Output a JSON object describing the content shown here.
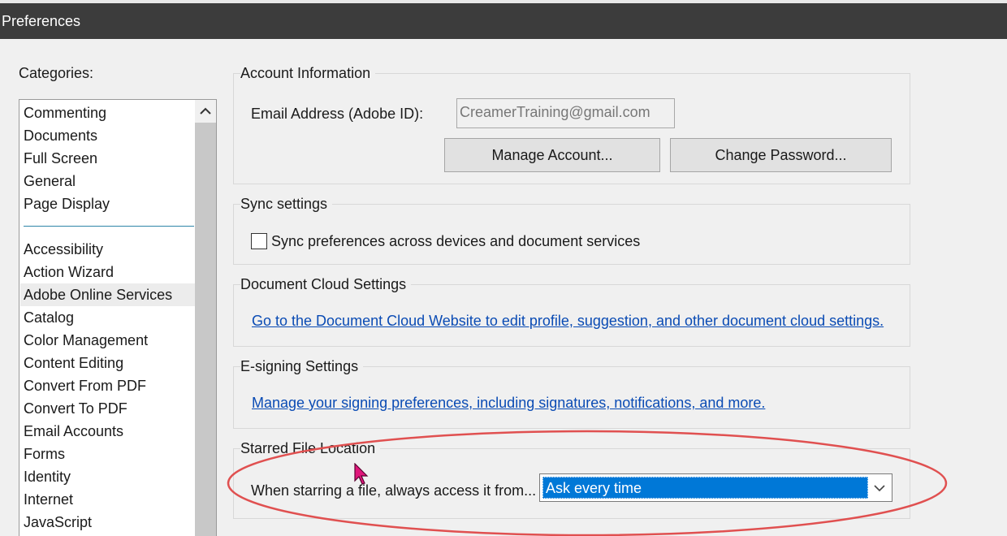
{
  "window": {
    "title": "Preferences"
  },
  "categories": {
    "label": "Categories:",
    "top_items": [
      "Commenting",
      "Documents",
      "Full Screen",
      "General",
      "Page Display"
    ],
    "items": [
      "Accessibility",
      "Action Wizard",
      "Adobe Online Services",
      "Catalog",
      "Color Management",
      "Content Editing",
      "Convert From PDF",
      "Convert To PDF",
      "Email Accounts",
      "Forms",
      "Identity",
      "Internet",
      "JavaScript"
    ],
    "selected": "Adobe Online Services"
  },
  "account": {
    "title": "Account Information",
    "email_label": "Email Address (Adobe ID):",
    "email_value": "CreamerTraining@gmail.com",
    "manage_button": "Manage Account...",
    "password_button": "Change Password..."
  },
  "sync": {
    "title": "Sync settings",
    "checkbox_label": "Sync preferences across devices and document services",
    "checked": false
  },
  "document_cloud": {
    "title": "Document Cloud Settings",
    "link": "Go to the Document Cloud Website to edit profile, suggestion, and other document cloud settings."
  },
  "esign": {
    "title": "E-signing Settings",
    "link": "Manage your signing preferences, including signatures, notifications, and more."
  },
  "starred": {
    "title": "Starred File Location",
    "label": "When starring a file, always access it from...",
    "selected_option": "Ask every time"
  },
  "colors": {
    "titlebar": "#3c3c3c",
    "link": "#0a4bb4",
    "select_highlight": "#0078d7",
    "annotation_ellipse": "#e05050",
    "cursor": "#e0157a"
  }
}
